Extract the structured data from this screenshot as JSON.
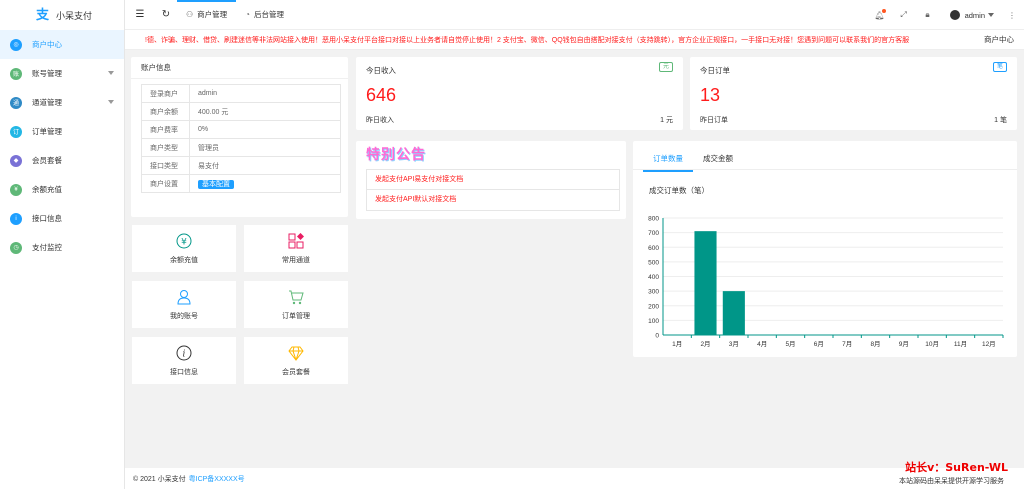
{
  "app": {
    "name": "小呆支付"
  },
  "sidebar": {
    "items": [
      {
        "label": "商户中心",
        "color": "#1e9fff"
      },
      {
        "label": "账号管理",
        "color": "#5fb878"
      },
      {
        "label": "通道管理",
        "color": "#2f8ac6"
      },
      {
        "label": "订单管理",
        "color": "#23b7e5"
      },
      {
        "label": "会员套餐",
        "color": "#7a72d6"
      },
      {
        "label": "余额充值",
        "color": "#5fb878"
      },
      {
        "label": "接口信息",
        "color": "#1e9fff"
      },
      {
        "label": "支付监控",
        "color": "#5fb878"
      }
    ]
  },
  "header": {
    "tabs": [
      {
        "label": "商户管理"
      },
      {
        "label": "后台管理"
      }
    ],
    "user": "admin"
  },
  "notice": {
    "text": "!德、诈骗、理财、借贷、刷建迷信等非法网站接入使用！恶用小呆支付平台接口对接以上业务者请自觉停止使用！2 支付宝、微信、QQ钱包自由搭配对接支付（支持跳转），官方企业正规接口，一手接口无对接！您遇到问题可以联系我们的官方客服",
    "breadcrumb": "商户中心"
  },
  "account": {
    "title": "账户信息",
    "rows": [
      {
        "k": "登录商户",
        "v": "admin"
      },
      {
        "k": "商户余额",
        "v": "400.00 元"
      },
      {
        "k": "商户费率",
        "v": "0%"
      },
      {
        "k": "商户类型",
        "v": "管理员"
      },
      {
        "k": "接口类型",
        "v": "易支付"
      },
      {
        "k": "商户设置",
        "v": "基本配置"
      }
    ]
  },
  "income": {
    "title": "今日收入",
    "tag": "元",
    "value": "646",
    "sub": "昨日收入",
    "sub_value": "1 元"
  },
  "orders": {
    "title": "今日订单",
    "tag": "笔",
    "value": "13",
    "sub": "昨日订单",
    "sub_value": "1 笔"
  },
  "announce": {
    "title": "特别公告",
    "items": [
      "发起支付API易支付对接文档",
      "发起支付API默认对接文档"
    ]
  },
  "tiles": [
    {
      "label": "余额充值"
    },
    {
      "label": "常用通道"
    },
    {
      "label": "我的账号"
    },
    {
      "label": "订单管理"
    },
    {
      "label": "接口信息"
    },
    {
      "label": "会员套餐"
    }
  ],
  "chart_tabs": [
    "订单数量",
    "成交金额"
  ],
  "chart_data": {
    "type": "bar",
    "title": "成交订单数（笔）",
    "categories": [
      "1月",
      "2月",
      "3月",
      "4月",
      "5月",
      "6月",
      "7月",
      "8月",
      "9月",
      "10月",
      "11月",
      "12月"
    ],
    "values": [
      0,
      710,
      300,
      0,
      0,
      0,
      0,
      0,
      0,
      0,
      0,
      0
    ],
    "ylim": [
      0,
      800
    ],
    "yticks": [
      0,
      100,
      200,
      300,
      400,
      500,
      600,
      700,
      800
    ],
    "color": "#009688",
    "grid": true
  },
  "footer": {
    "copyright": "© 2021 小呆支付",
    "icp": "粤ICP备XXXXX号"
  },
  "watermark": {
    "line1": "站长v：SuRen-WL",
    "line2": "本站源码由呆呆提供开源学习服务"
  }
}
